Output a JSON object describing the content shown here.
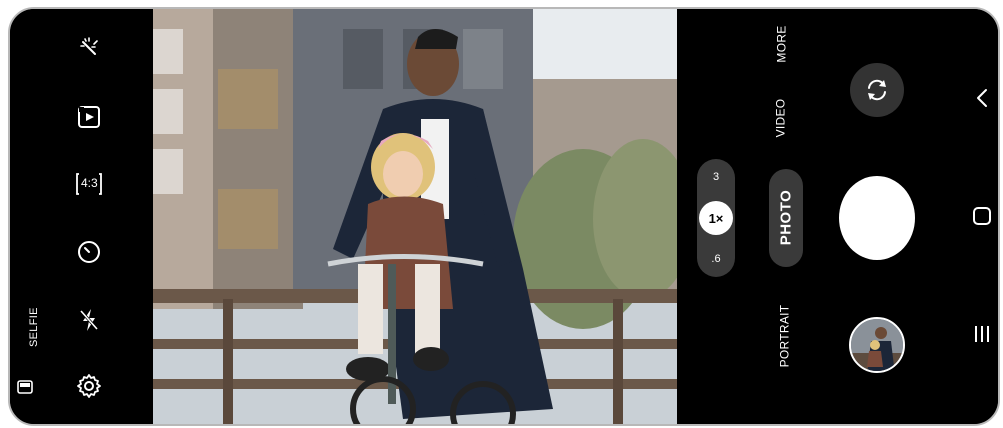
{
  "left_toolbar": {
    "icons": [
      "magic-wand-icon",
      "motion-photo-icon",
      "aspect-ratio-icon",
      "timer-icon",
      "flash-off-icon",
      "settings-gear-icon"
    ],
    "aspect_ratio_label": "4:3",
    "selfie_label": "SELFIE"
  },
  "zoom": {
    "options": [
      "3",
      "1×",
      ".6"
    ],
    "selected": "1×"
  },
  "modes": {
    "more": "MORE",
    "video": "VIDEO",
    "photo": "PHOTO",
    "portrait": "PORTRAIT",
    "selected": "PHOTO"
  },
  "controls": {
    "flip_icon": "camera-flip-icon",
    "shutter_icon": "shutter-button",
    "gallery_icon": "gallery-thumbnail"
  },
  "nav": {
    "icons": [
      "back-icon",
      "home-icon",
      "recents-icon"
    ]
  },
  "colors": {
    "panel_bg": "#000000",
    "pill_bg": "#3a3a3a",
    "flip_bg": "#333333",
    "shutter": "#ffffff"
  }
}
